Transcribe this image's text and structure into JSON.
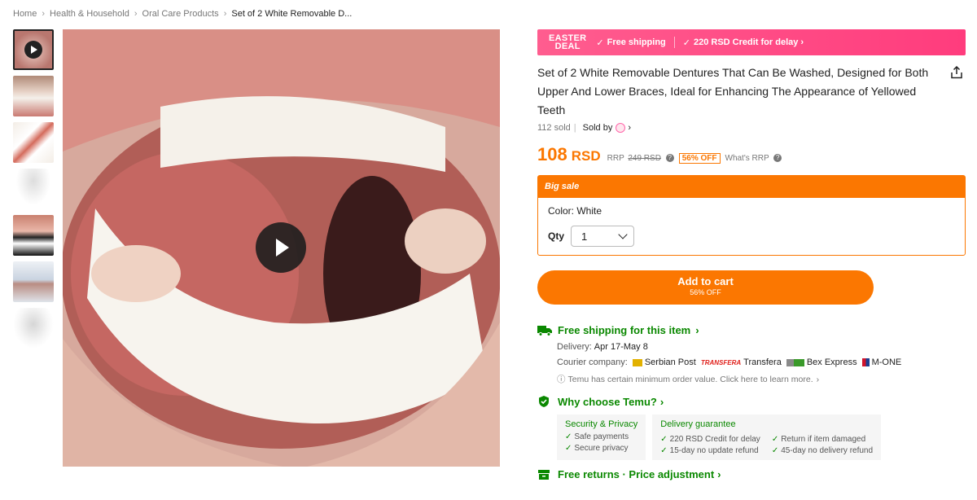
{
  "breadcrumb": [
    "Home",
    "Health & Household",
    "Oral Care Products",
    "Set of 2 White Removable D..."
  ],
  "gallery": {
    "thumb_count": 7,
    "active_index": 0
  },
  "deal": {
    "tag_line1": "EASTER",
    "tag_line2": "DEAL",
    "free_shipping": "Free shipping",
    "credit": "220 RSD Credit for delay",
    "accent": "#ff3c7d"
  },
  "product": {
    "title": "Set of 2 White Removable Dentures That Can Be Washed, Designed for Both Upper And Lower Braces, Ideal for Enhancing The Appearance of Yellowed Teeth",
    "sold": "112 sold",
    "sold_by": "Sold by"
  },
  "price": {
    "value": "108",
    "currency": "RSD",
    "rrp_label": "RRP",
    "rrp_value": "249 RSD",
    "off": "56% OFF",
    "whats_rrp": "What's RRP",
    "accent": "#fb7701"
  },
  "sale": {
    "header": "Big sale",
    "color_label": "Color: White",
    "qty_label": "Qty",
    "qty_value": "1"
  },
  "cart": {
    "label": "Add to cart",
    "sub": "56% OFF"
  },
  "shipping": {
    "title": "Free shipping for this item",
    "delivery_label": "Delivery:",
    "delivery_value": "Apr 17-May 8",
    "courier_label": "Courier company:",
    "couriers": [
      "Serbian Post",
      "Transfera",
      "Bex Express",
      "M-ONE"
    ],
    "courier_logo_text": "TRANSFERA",
    "min_order": "Temu has certain minimum order value. Click here to learn more.",
    "green": "#0a8800"
  },
  "why": {
    "title": "Why choose Temu?",
    "security_title": "Security & Privacy",
    "security_items": [
      "Safe payments",
      "Secure privacy"
    ],
    "delivery_title": "Delivery guarantee",
    "delivery_items": [
      "220 RSD Credit for delay",
      "Return if item damaged",
      "15-day no update refund",
      "45-day no delivery refund"
    ]
  },
  "returns": {
    "title": "Free returns · Price adjustment"
  }
}
